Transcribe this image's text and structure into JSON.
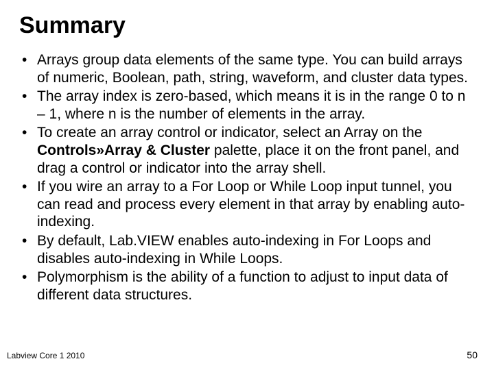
{
  "title": "Summary",
  "bullets": [
    {
      "pre": "Arrays group data elements of the same type. You can build arrays of numeric, Boolean, path, string, waveform, and cluster data types.",
      "bold": "",
      "post": ""
    },
    {
      "pre": "The array index is zero-based, which means it is in the range 0 to n – 1, where n is the number of elements in the array.",
      "bold": "",
      "post": ""
    },
    {
      "pre": "To create an array control or indicator, select an Array on the ",
      "bold": "Controls»Array & Cluster",
      "post": " palette, place it on the front panel, and drag a control or indicator into the array shell."
    },
    {
      "pre": "If you wire an array to a For Loop or While Loop input tunnel, you can read and process every element in that array by enabling auto-indexing.",
      "bold": "",
      "post": ""
    },
    {
      "pre": "By default, Lab.VIEW enables auto-indexing in For Loops and disables auto-indexing in While Loops.",
      "bold": "",
      "post": ""
    },
    {
      "pre": "Polymorphism is the ability of a function to adjust to input data of different data structures.",
      "bold": "",
      "post": ""
    }
  ],
  "footer_left": "Labview Core 1 2010",
  "footer_right": "50"
}
